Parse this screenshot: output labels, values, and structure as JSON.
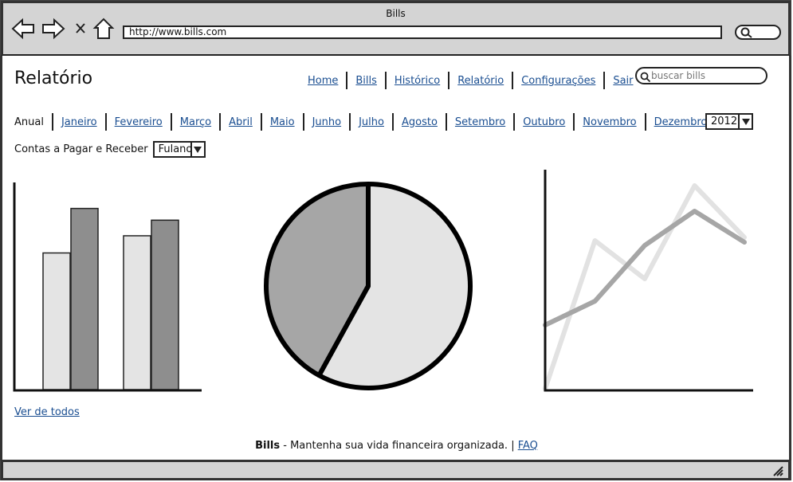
{
  "window": {
    "title": "Bills"
  },
  "browser": {
    "url": "http://www.bills.com"
  },
  "page": {
    "title": "Relatório"
  },
  "topnav": [
    {
      "label": "Home"
    },
    {
      "label": "Bills"
    },
    {
      "label": "Histórico"
    },
    {
      "label": "Relatório"
    },
    {
      "label": "Configurações"
    },
    {
      "label": "Sair"
    }
  ],
  "search": {
    "placeholder": "buscar bills"
  },
  "months": {
    "current": "Anual",
    "links": [
      "Janeiro",
      "Fevereiro",
      "Março",
      "Abril",
      "Maio",
      "Junho",
      "Julho",
      "Agosto",
      "Setembro",
      "Outubro",
      "Novembro",
      "Dezembro"
    ]
  },
  "year": {
    "selected": "2012"
  },
  "filter": {
    "label": "Contas a Pagar e Receber",
    "person": "Fulano"
  },
  "see_all": "Ver de todos",
  "footer": {
    "brand": "Bills",
    "text": " - Mantenha sua vida financeira organizada. | ",
    "faq": "FAQ"
  },
  "colors": {
    "link": "#1a4e91",
    "light": "#e4e4e4",
    "mid": "#a6a6a6",
    "dark": "#8e8e8e",
    "chrome": "#d4d4d4"
  },
  "chart_data": [
    {
      "type": "bar",
      "categories": [
        "",
        ""
      ],
      "series": [
        {
          "values": [
            175,
            197
          ]
        },
        {
          "values": [
            232,
            217
          ]
        }
      ],
      "ylim": [
        0,
        260
      ]
    },
    {
      "type": "pie",
      "values": [
        58,
        42
      ]
    },
    {
      "type": "line",
      "x": [
        0,
        1,
        2,
        3,
        4
      ],
      "series": [
        {
          "values": [
            0,
            186,
            138,
            255,
            190
          ]
        },
        {
          "values": [
            80,
            110,
            180,
            223,
            184
          ]
        }
      ],
      "ylim": [
        0,
        275
      ]
    }
  ]
}
